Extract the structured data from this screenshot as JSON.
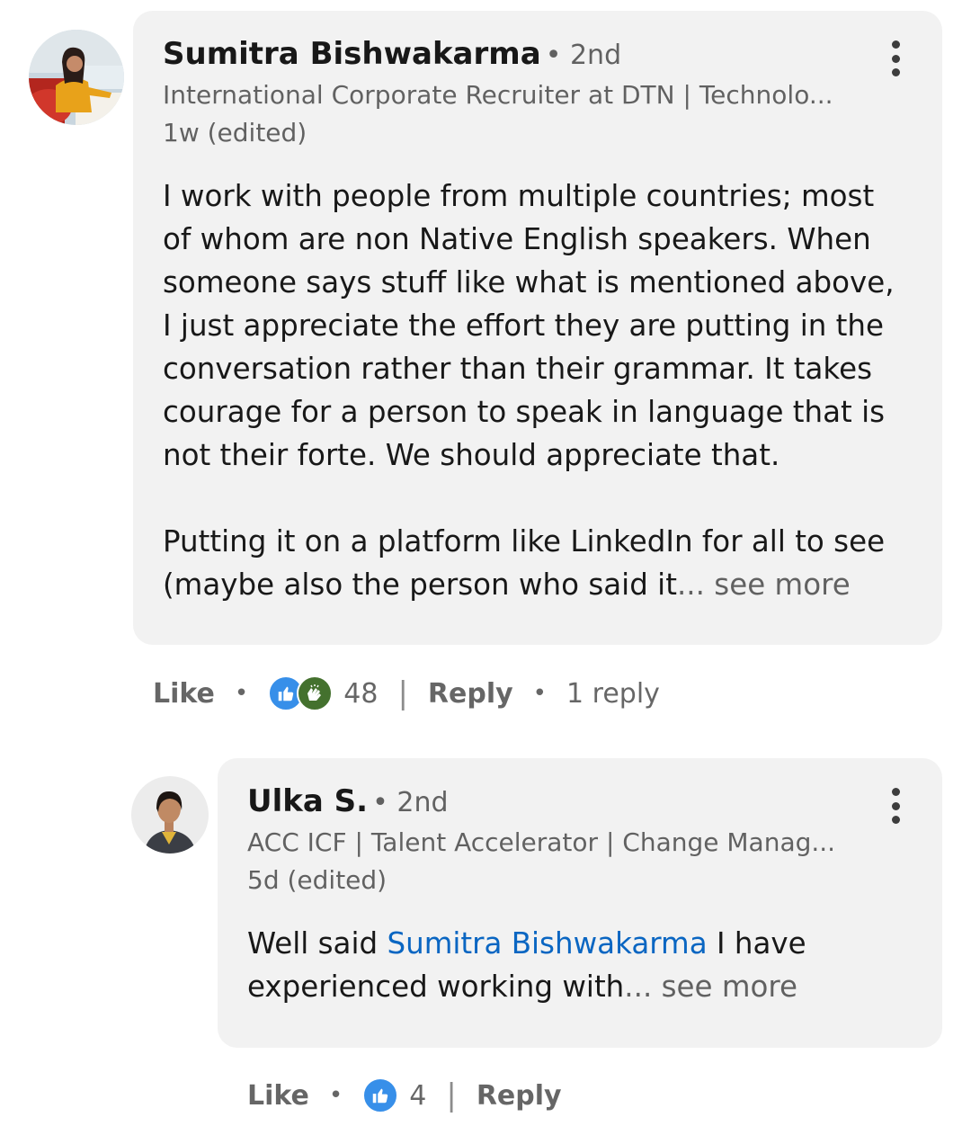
{
  "comment": {
    "author_name": "Sumitra Bishwakarma",
    "degree": "• 2nd",
    "headline": "International Corporate Recruiter at DTN | Technolo...",
    "time": "1w (edited)",
    "body_lines": [
      "I work with people from multiple countries; most",
      "of whom are non Native English speakers. When",
      "someone says stuff like what is mentioned above,",
      "I just appreciate the effort they are putting in the",
      "conversation rather than their grammar. It takes",
      "courage for a person to speak in language that is",
      "not their forte. We should appreciate that."
    ],
    "body_line_p2_1": "Putting it on a platform like LinkedIn for all to see",
    "body_line_p2_2": "(maybe also the person who said it",
    "see_more": "... see more",
    "like_label": "Like",
    "reaction_count": "48",
    "reply_label": "Reply",
    "replies_count": "1 reply",
    "reactions": [
      "like-icon",
      "celebrate-icon"
    ]
  },
  "reply": {
    "author_name": "Ulka S.",
    "degree": "• 2nd",
    "headline": "ACC ICF | Talent Accelerator | Change Manag...",
    "time": "5d (edited)",
    "text_before": "Well said ",
    "mention": "Sumitra Bishwakarma",
    "text_after": " I have",
    "line2": "experienced working with",
    "see_more": "... see more",
    "like_label": "Like",
    "reaction_count": "4",
    "reply_label": "Reply",
    "reactions": [
      "like-icon"
    ]
  },
  "colors": {
    "bubble": "#f2f2f2",
    "mention": "#0a66c2",
    "like_reaction": "#378fe9",
    "celebrate_reaction": "#44712e"
  }
}
